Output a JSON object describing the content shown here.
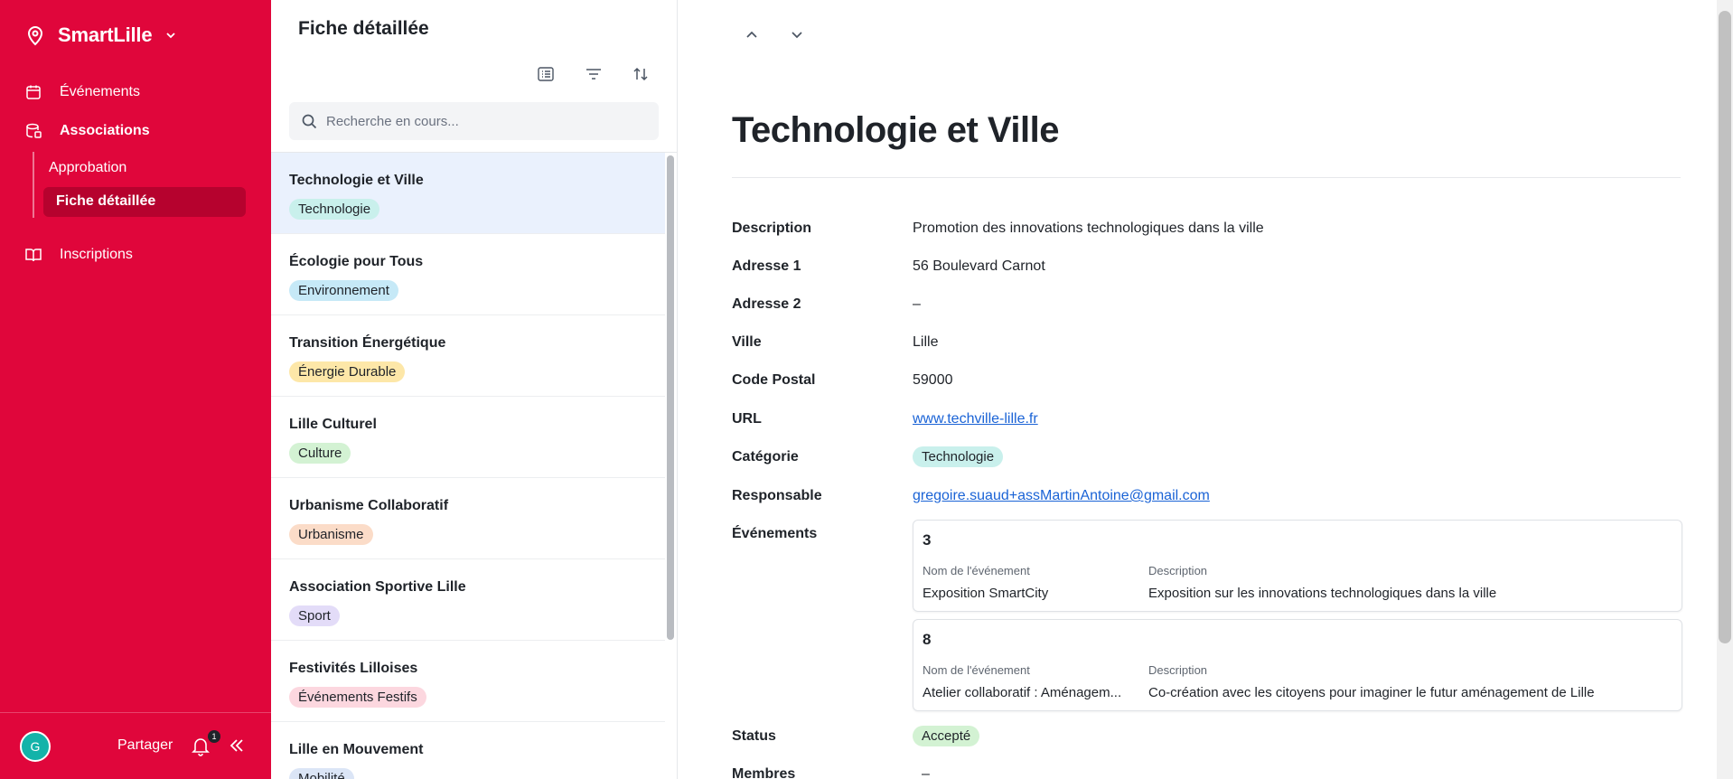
{
  "app": {
    "name": "SmartLille"
  },
  "sidebar": {
    "items": [
      {
        "label": "Événements"
      },
      {
        "label": "Associations"
      },
      {
        "label": "Inscriptions"
      }
    ],
    "subitems": [
      {
        "label": "Approbation"
      },
      {
        "label": "Fiche détaillée"
      }
    ],
    "footer": {
      "avatar_letter": "G",
      "share_label": "Partager",
      "notification_count": "1"
    }
  },
  "list": {
    "title": "Fiche détaillée",
    "search_placeholder": "Recherche en cours...",
    "items": [
      {
        "name": "Technologie et Ville",
        "tag": "Technologie",
        "tag_color": "#c9f0ec"
      },
      {
        "name": "Écologie pour Tous",
        "tag": "Environnement",
        "tag_color": "#c6e9f7"
      },
      {
        "name": "Transition Énergétique",
        "tag": "Énergie Durable",
        "tag_color": "#fde7a8"
      },
      {
        "name": "Lille Culturel",
        "tag": "Culture",
        "tag_color": "#d3f2d3"
      },
      {
        "name": "Urbanisme Collaboratif",
        "tag": "Urbanisme",
        "tag_color": "#fbdcc8"
      },
      {
        "name": "Association Sportive Lille",
        "tag": "Sport",
        "tag_color": "#e3dcf8"
      },
      {
        "name": "Festivités Lilloises",
        "tag": "Événements Festifs",
        "tag_color": "#fcd7df"
      },
      {
        "name": "Lille en Mouvement",
        "tag": "Mobilité",
        "tag_color": "#dbe5f6"
      }
    ]
  },
  "detail": {
    "title": "Technologie et Ville",
    "fields": {
      "description_label": "Description",
      "description": "Promotion des innovations technologiques dans la ville",
      "adresse1_label": "Adresse 1",
      "adresse1": "56 Boulevard Carnot",
      "adresse2_label": "Adresse 2",
      "adresse2": "–",
      "ville_label": "Ville",
      "ville": "Lille",
      "code_postal_label": "Code Postal",
      "code_postal": "59000",
      "url_label": "URL",
      "url": "www.techville-lille.fr",
      "categorie_label": "Catégorie",
      "categorie": "Technologie",
      "responsable_label": "Responsable",
      "responsable": "gregoire.suaud+assMartinAntoine@gmail.com",
      "evenements_label": "Événements",
      "status_label": "Status",
      "status": "Accepté",
      "membres_label": "Membres",
      "membres": "–"
    },
    "events": [
      {
        "id": "3",
        "name_header": "Nom de l'événement",
        "desc_header": "Description",
        "name": "Exposition SmartCity",
        "description": "Exposition sur les innovations technologiques dans la ville"
      },
      {
        "id": "8",
        "name_header": "Nom de l'événement",
        "desc_header": "Description",
        "name": "Atelier collaboratif : Aménagem...",
        "description": "Co-création avec les citoyens pour imaginer le futur aménagement de Lille"
      }
    ]
  },
  "colors": {
    "brand": "#e0063b",
    "brand_active": "#b6022e",
    "selected_row": "#eaf1fd",
    "link": "#1a63d6",
    "status_ok": "#d3f2d3"
  }
}
